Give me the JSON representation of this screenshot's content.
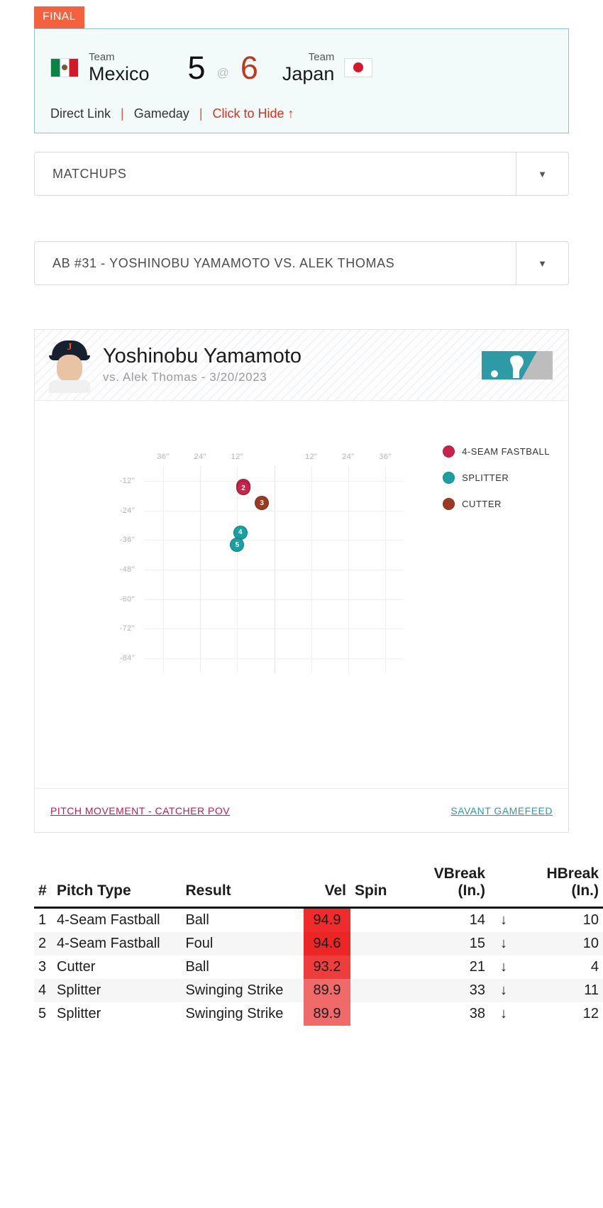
{
  "scoreboard": {
    "status_tag": "FINAL",
    "away": {
      "team_label": "Team",
      "name": "Mexico",
      "score": "5",
      "flag": "mexico-flag-icon"
    },
    "at_symbol": "@",
    "home": {
      "team_label": "Team",
      "name": "Japan",
      "score": "6",
      "flag": "japan-flag-icon"
    },
    "links": {
      "direct_link": "Direct Link",
      "sep1": "|",
      "gameday": "Gameday",
      "sep2": "|",
      "hide": "Click to Hide ↑"
    },
    "colors": {
      "tag_bg": "#f4613c",
      "home_score": "#c0391b",
      "hide_link": "#d6321f",
      "box_border": "#8fc3cd",
      "box_bg": "#f2fafa"
    }
  },
  "selectors": [
    {
      "value": "MATCHUPS",
      "arrow": "▼"
    },
    {
      "value": "AB #31 - YOSHINOBU YAMAMOTO VS. ALEK THOMAS",
      "arrow": "▼"
    }
  ],
  "card": {
    "player_name": "Yoshinobu Yamamoto",
    "subtitle": "vs. Alek Thomas - 3/20/2023",
    "avatar_name": "player-headshot",
    "logo_name": "mlb-logo",
    "footer_left": "PITCH MOVEMENT - CATCHER POV",
    "footer_right": "SAVANT GAMEFEED"
  },
  "chart_data": {
    "type": "scatter",
    "title": "PITCH MOVEMENT - CATCHER POV",
    "xlabel": "",
    "ylabel": "",
    "xlim": [
      -42,
      42
    ],
    "ylim": [
      -90,
      -6
    ],
    "grid": true,
    "legend_position": "right",
    "xticks": [
      {
        "label": "36\"",
        "value": -36
      },
      {
        "label": "24\"",
        "value": -24
      },
      {
        "label": "12\"",
        "value": -12
      },
      {
        "label": "12\"",
        "value": 12
      },
      {
        "label": "24\"",
        "value": 24
      },
      {
        "label": "36\"",
        "value": 36
      }
    ],
    "yticks": [
      {
        "label": "-12\"",
        "value": -12
      },
      {
        "label": "-24\"",
        "value": -24
      },
      {
        "label": "-36\"",
        "value": -36
      },
      {
        "label": "-48\"",
        "value": -48
      },
      {
        "label": "-60\"",
        "value": -60
      },
      {
        "label": "-72\"",
        "value": -72
      },
      {
        "label": "-84\"",
        "value": -84
      }
    ],
    "legend": [
      {
        "name": "4-SEAM FASTBALL",
        "color": "#c9234a"
      },
      {
        "name": "SPLITTER",
        "color": "#19a0a0"
      },
      {
        "name": "CUTTER",
        "color": "#9c3a1f"
      }
    ],
    "series": [
      {
        "name": "4-SEAM FASTBALL",
        "color": "#c9234a",
        "points": [
          {
            "label": "1",
            "x": -10,
            "y": -14
          },
          {
            "label": "2",
            "x": -10,
            "y": -15
          }
        ]
      },
      {
        "name": "CUTTER",
        "color": "#9c3a1f",
        "points": [
          {
            "label": "3",
            "x": -4,
            "y": -21
          }
        ]
      },
      {
        "name": "SPLITTER",
        "color": "#19a0a0",
        "points": [
          {
            "label": "4",
            "x": -11,
            "y": -33
          },
          {
            "label": "5",
            "x": -12,
            "y": -38
          }
        ]
      }
    ]
  },
  "table": {
    "headers": {
      "num": "#",
      "pitch_type": "Pitch Type",
      "result": "Result",
      "vel": "Vel",
      "spin": "Spin",
      "vbreak_l1": "VBreak",
      "vbreak_l2": "(In.)",
      "hbreak_l1": "HBreak",
      "hbreak_l2": "(In.)"
    },
    "rows": [
      {
        "num": "1",
        "pitch_type": "4-Seam Fastball",
        "result": "Ball",
        "vel": "94.9",
        "spin": "",
        "vbreak": "14",
        "arrow": "↓",
        "hbreak": "10",
        "vel_bg": "#ef2b2b"
      },
      {
        "num": "2",
        "pitch_type": "4-Seam Fastball",
        "result": "Foul",
        "vel": "94.6",
        "spin": "",
        "vbreak": "15",
        "arrow": "↓",
        "hbreak": "10",
        "vel_bg": "#ec2525"
      },
      {
        "num": "3",
        "pitch_type": "Cutter",
        "result": "Ball",
        "vel": "93.2",
        "spin": "",
        "vbreak": "21",
        "arrow": "↓",
        "hbreak": "4",
        "vel_bg": "#ef3d3d"
      },
      {
        "num": "4",
        "pitch_type": "Splitter",
        "result": "Swinging Strike",
        "vel": "89.9",
        "spin": "",
        "vbreak": "33",
        "arrow": "↓",
        "hbreak": "11",
        "vel_bg": "#f16a6a"
      },
      {
        "num": "5",
        "pitch_type": "Splitter",
        "result": "Swinging Strike",
        "vel": "89.9",
        "spin": "",
        "vbreak": "38",
        "arrow": "↓",
        "hbreak": "12",
        "vel_bg": "#f16a6a"
      }
    ]
  }
}
